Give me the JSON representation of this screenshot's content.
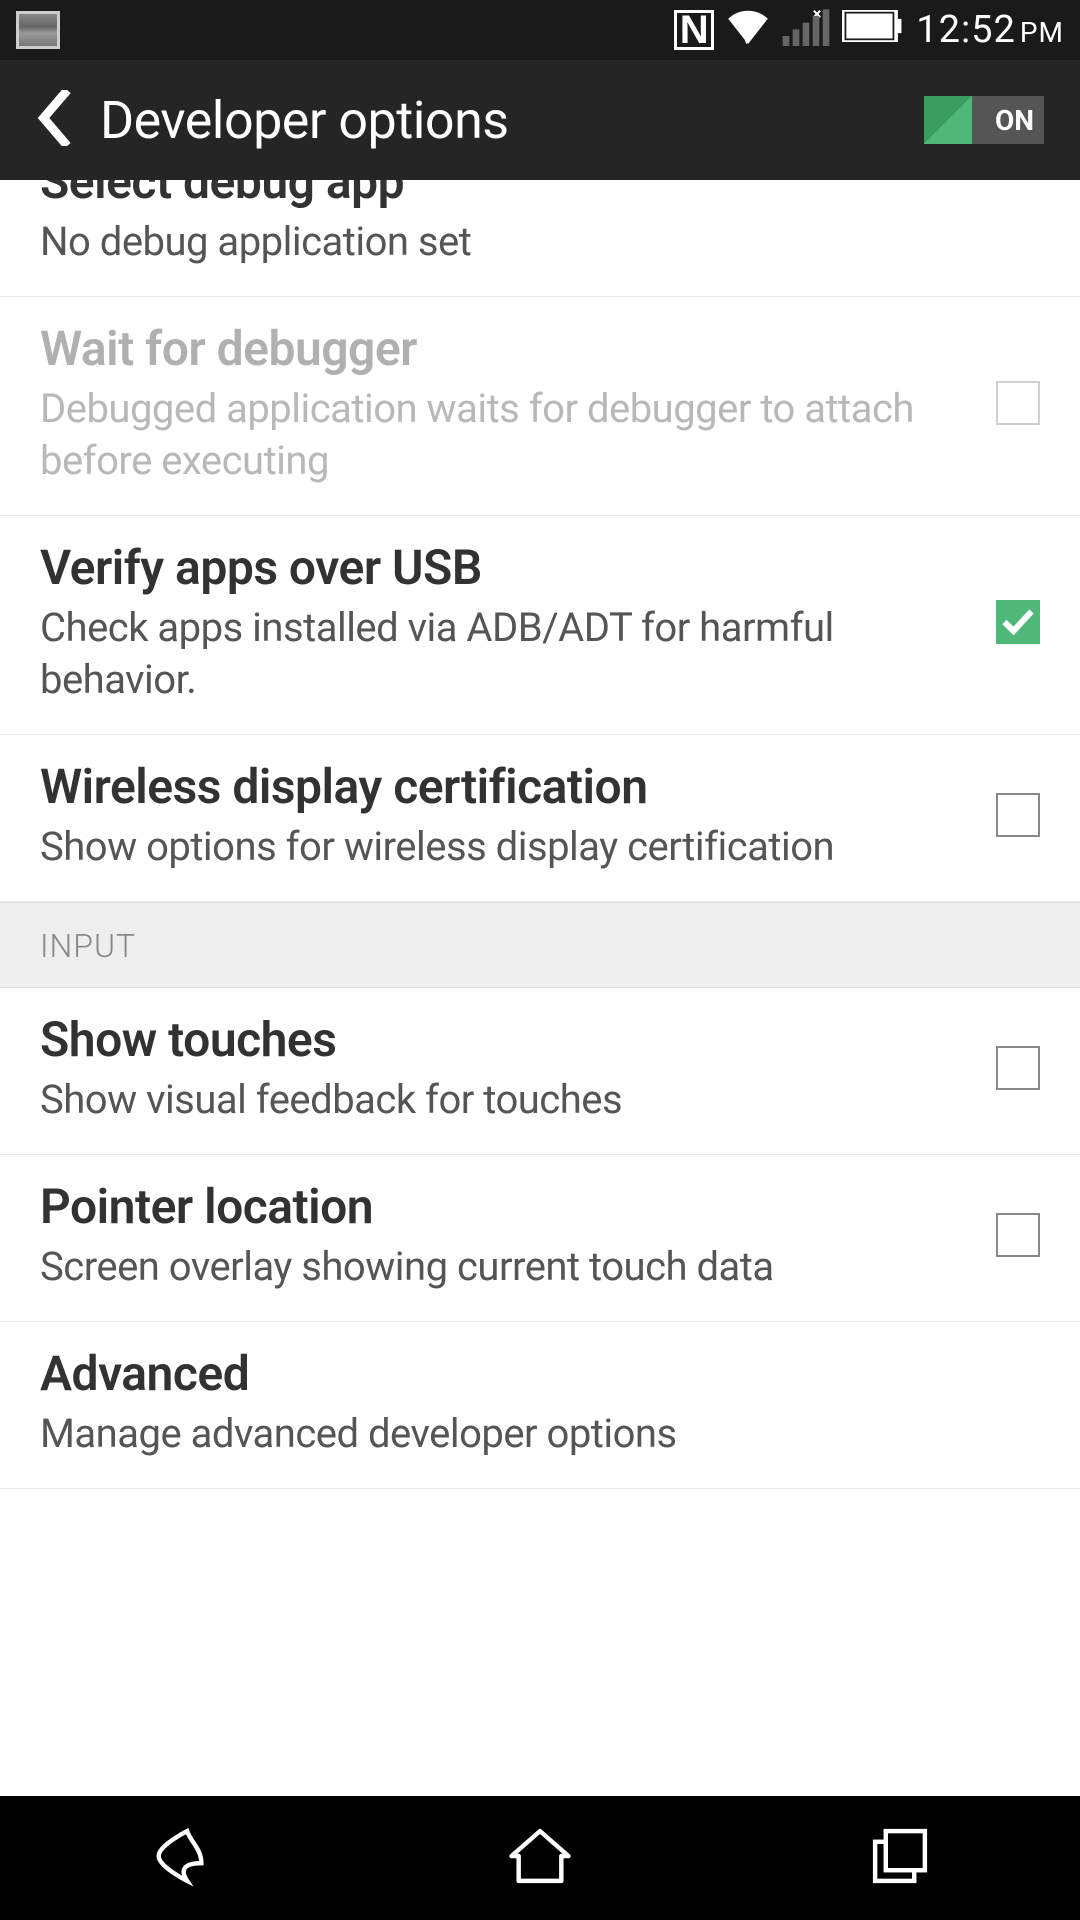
{
  "status": {
    "time": "12:52",
    "ampm": "PM",
    "nfc_label": "N"
  },
  "actionbar": {
    "title": "Developer options",
    "toggle_state": "ON"
  },
  "settings": [
    {
      "title": "Select debug app",
      "subtitle": "No debug application set",
      "hasCheckbox": false,
      "checked": false,
      "disabled": false,
      "partial": true
    },
    {
      "title": "Wait for debugger",
      "subtitle": "Debugged application waits for debugger to attach before executing",
      "hasCheckbox": true,
      "checked": false,
      "disabled": true
    },
    {
      "title": "Verify apps over USB",
      "subtitle": "Check apps installed via ADB/ADT for harmful behavior.",
      "hasCheckbox": true,
      "checked": true,
      "disabled": false
    },
    {
      "title": "Wireless display certification",
      "subtitle": "Show options for wireless display certification",
      "hasCheckbox": true,
      "checked": false,
      "disabled": false
    }
  ],
  "section_header": "INPUT",
  "input_settings": [
    {
      "title": "Show touches",
      "subtitle": "Show visual feedback for touches",
      "hasCheckbox": true,
      "checked": false
    },
    {
      "title": "Pointer location",
      "subtitle": "Screen overlay showing current touch data",
      "hasCheckbox": true,
      "checked": false
    },
    {
      "title": "Advanced",
      "subtitle": "Manage advanced developer options",
      "hasCheckbox": false,
      "checked": false
    }
  ]
}
